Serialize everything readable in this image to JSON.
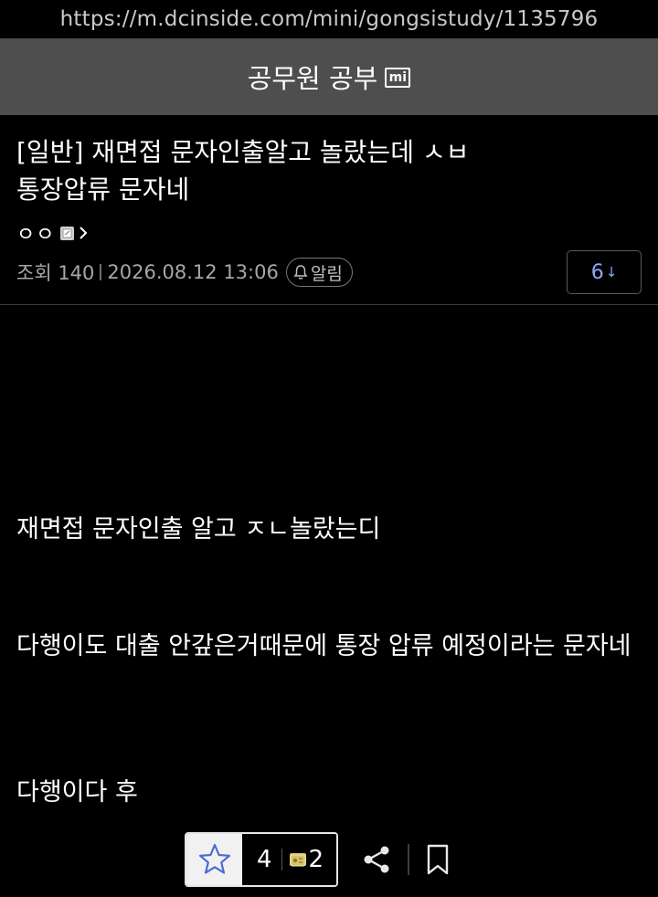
{
  "browser": {
    "url": "https://m.dcinside.com/mini/gongsistudy/1135796"
  },
  "gallery": {
    "title": "공무원 공부",
    "badge": "mi"
  },
  "post": {
    "title": "[일반] 재면접 문자인출알고 놀랐는데 ㅅㅂ 통장압류 문자네",
    "author": "ㅇㅇ",
    "views_label": "조회 140",
    "date": "2026.08.12 13:06",
    "alert_label": "알림",
    "comment_count": "6",
    "comment_arrow": "↓",
    "body": [
      "재면접 문자인출 알고 ㅈㄴ놀랐는디",
      "다행이도 대출 안갚은거때문에 통장 압류 예정이라는 문자네",
      "다행이다 후"
    ]
  },
  "reactions": {
    "recommend_count": "4",
    "fixed_count": "2"
  },
  "icons": {
    "author": "gallery-member-icon",
    "alert": "bell-icon",
    "recommend": "star-icon",
    "fixed": "fixed-recommend-icon",
    "share": "share-icon",
    "bookmark": "bookmark-icon"
  },
  "colors": {
    "background": "#000000",
    "header": "#4e4e4e",
    "accent_comment": "#8ea8ff",
    "muted_text": "#a7a7a7"
  }
}
